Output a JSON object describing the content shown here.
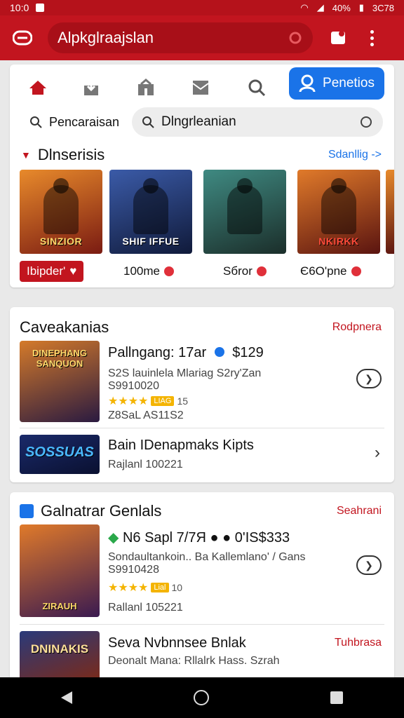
{
  "status": {
    "time": "10:0",
    "battery": "40%",
    "right_text": "3C78"
  },
  "appbar": {
    "search_text": "Alpkglraajslan"
  },
  "nav": {
    "profile_label": "Penetios"
  },
  "search": {
    "label": "Pencaraisan",
    "placeholder": "Dlngrleanian"
  },
  "featured": {
    "title": "Dlnserisis",
    "link": "Sdanllig ->",
    "tiles": [
      {
        "art": "SINZIOR",
        "price": "Ibipder'",
        "style": "red"
      },
      {
        "art": "SHIF IFFUE",
        "price": "100me"
      },
      {
        "art": "",
        "price": "Sбror"
      },
      {
        "art": "NKIRKK",
        "price": "Є6O'pne"
      }
    ]
  },
  "section2": {
    "title": "Caveakanias",
    "link": "Rodpnera",
    "rows": [
      {
        "title": "Pallngang: 17ar",
        "price": "$129",
        "sub1": "S2S lauinlela Mlariag S2ry'Zan",
        "sub2": "S9910020",
        "rating": "15",
        "tag": "LIAG",
        "footer": "Z8SaL AS11S2",
        "thumb": "DINEPHANG SANQUON"
      },
      {
        "title": "Bain IDenapmaks Kipts",
        "sub1": "Rajlanl 100221",
        "thumb": "SOSSUAS"
      }
    ]
  },
  "section3": {
    "title": "Galnatrar Genlals",
    "link": "Seahrani",
    "rows": [
      {
        "title": "N6 Sapl 7/7Я",
        "price": "0'IS$333",
        "sub1": "Sondaultankoin.. Ba Kallemlano' / Gans",
        "sub2": "S9910428",
        "rating": "10",
        "tag": "Lial",
        "footer": "Rallanl 105221",
        "thumb": "ZIRAUH"
      },
      {
        "title": "Seva Nvbnnsee Bnlak",
        "sub1": "Deonalt Mana: Rllalrk Hass. Szrah",
        "link": "Tuhbrasa",
        "thumb": "DNINAKIS"
      }
    ]
  },
  "colors": {
    "brand": "#c2151f",
    "accent": "#1a73e8",
    "star": "#f4b400"
  }
}
